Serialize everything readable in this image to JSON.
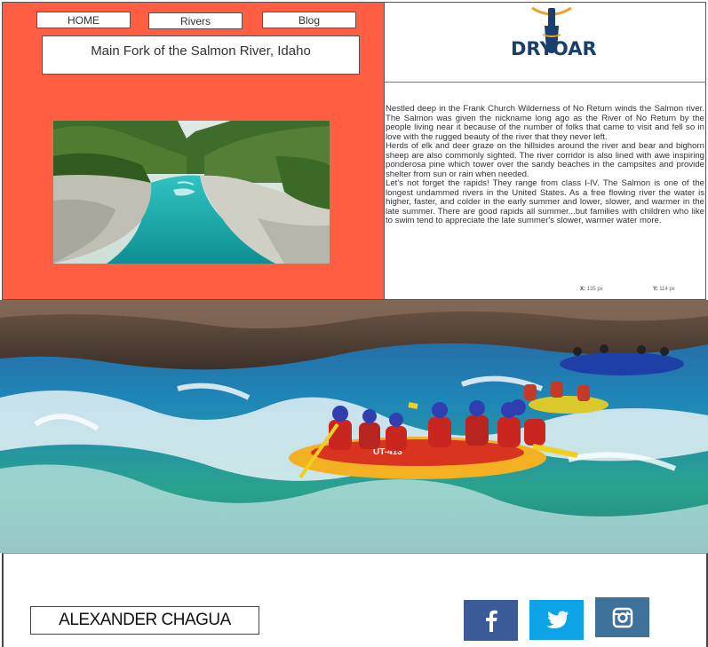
{
  "nav": {
    "home": "HOME",
    "rivers": "Rivers",
    "blog": "Blog"
  },
  "page_title": "Main Fork of the Salmon River, Idaho",
  "logo": {
    "text": "DRYOAR",
    "color": "#1b3f6b"
  },
  "article": {
    "paragraphs": [
      "Nestled deep in the Frank Church Wilderness of No Return winds the Salmon river. The Salmon was given the nickname long ago as the River of No Return by the people living near it because of the number of folks that came to visit and fell so in love with the rugged beauty of the river that they never left.",
      "Herds of elk and deer graze on the hillsides around the river and bear and bighorn sheep are also commonly sighted. The river corridor is also lined with awe inspiring ponderosa pine which tower over the sandy beaches in the campsites and provide shelter from sun or rain when needed.",
      "Let's not forget the rapids! They range from class I-IV. The Salmon is one of the longest undammed rivers in the United States. As a free flowing river the water is higher, faster, and colder in the early summer and lower, slower, and warmer in the late summer. There are good rapids all summer...but families with children who like to swim tend to appreciate the late summer's slower, warmer water more."
    ]
  },
  "coords": {
    "x_label": "X:",
    "x_value": "135 px",
    "y_label": "Y:",
    "y_value": "114 px"
  },
  "raft_id": "UT-413",
  "footer": {
    "name": "ALEXANDER CHAGUA",
    "social": [
      {
        "name": "facebook",
        "icon": "facebook-icon",
        "color": "#3b5b98"
      },
      {
        "name": "twitter",
        "icon": "twitter-icon",
        "color": "#0ea3e6"
      },
      {
        "name": "instagram",
        "icon": "instagram-icon",
        "color": "#3f729b"
      }
    ]
  },
  "colors": {
    "panel_bg": "#ff5e42",
    "water": "#1fb8b4"
  }
}
